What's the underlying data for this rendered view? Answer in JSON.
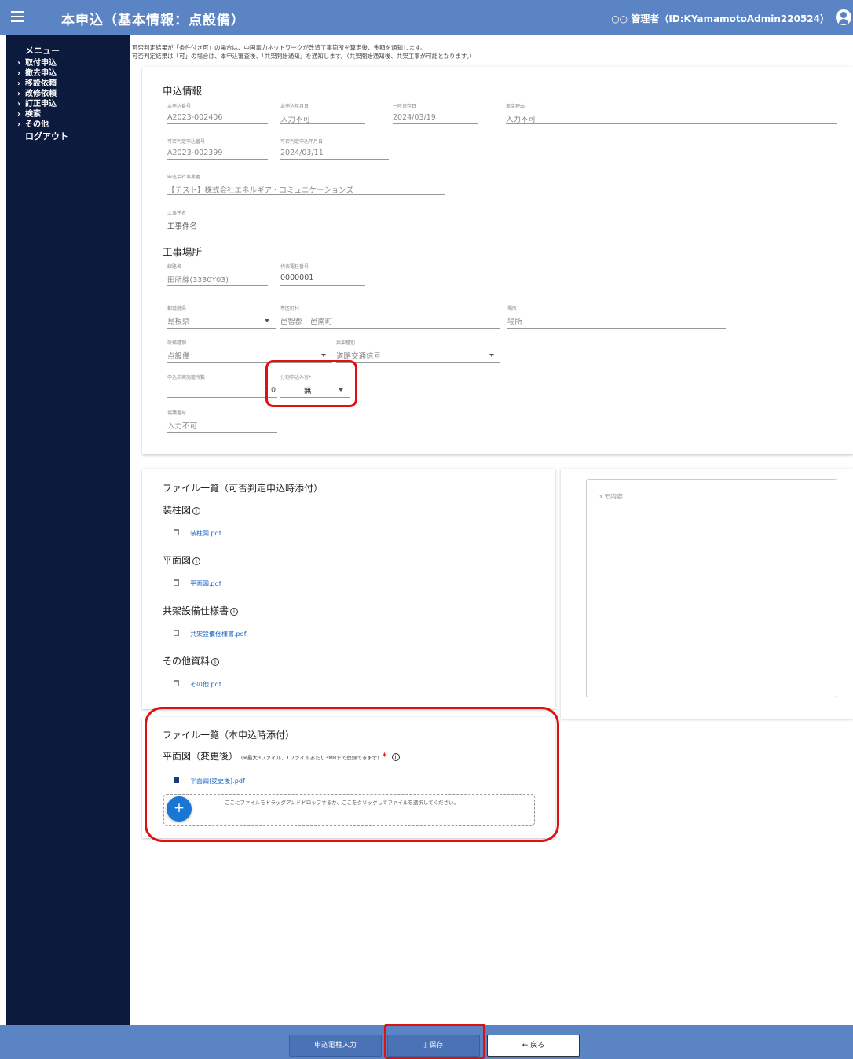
{
  "header": {
    "title": "本申込（基本情報：点設備）",
    "user": "○○ 管理者（ID:KYamamotoAdmin220524）"
  },
  "sidebar": {
    "title": "メニュー",
    "items": [
      {
        "label": "取付申込"
      },
      {
        "label": "撤去申込"
      },
      {
        "label": "移設依頼"
      },
      {
        "label": "改修依頼"
      },
      {
        "label": "訂正申込"
      },
      {
        "label": "検索"
      },
      {
        "label": "その他"
      }
    ],
    "logout": "ログアウト"
  },
  "notices": [
    "可否判定結果が「条件付き可」の場合は、中国電力ネットワークが改造工事箇所を算定後、金額を通知します。",
    "可否判定結果は「可」の場合は、本申込審査後、「共架開始通知」を通知します。（共架開始通知後、共架工事が可能となります。）"
  ],
  "application": {
    "section_title": "申込情報",
    "fields": {
      "app_number": {
        "label": "本申込番号",
        "value": "A2023-002406"
      },
      "app_date": {
        "label": "本申込年月日",
        "value": "入力不可"
      },
      "save_date": {
        "label": "一時保存日",
        "value": "2024/03/19"
      },
      "reject_reason": {
        "label": "差戻理由",
        "value": "入力不可"
      },
      "judge_number": {
        "label": "可否判定申込番号",
        "value": "A2023-002399"
      },
      "judge_date": {
        "label": "可否判定申込年月日",
        "value": "2024/03/11"
      },
      "applicant": {
        "label": "申込会社事業者",
        "value": "【テスト】株式会社エネルギア・コミュニケーションズ"
      },
      "construction_name": {
        "label": "工事件名",
        "value": "工事件名"
      }
    }
  },
  "location": {
    "section_title": "工事場所",
    "fields": {
      "line_name": {
        "label": "線路名",
        "value": "田所線(3330Y03)"
      },
      "pole_number": {
        "label": "代表電柱番号",
        "value": "0000001"
      },
      "prefecture": {
        "label": "都道府県",
        "value": "島根県"
      },
      "city": {
        "label": "市区町村",
        "value": "邑智郡　邑南町"
      },
      "place": {
        "label": "場所",
        "value": "場所"
      },
      "equipment_type": {
        "label": "設備種別",
        "value": "点設備"
      },
      "frame_type": {
        "label": "共架種別",
        "value": "道路交通信号"
      },
      "unconstructed_count": {
        "label": "申込未実施箇所数",
        "value": "0"
      },
      "split_apply": {
        "label": "分割申込み有",
        "value": "無"
      },
      "agreement_number": {
        "label": "協議番号",
        "value": "入力不可"
      }
    }
  },
  "files_judge": {
    "heading": "ファイル一覧（可否判定申込時添付）",
    "categories": [
      {
        "label": "装柱図",
        "file": "装柱図.pdf"
      },
      {
        "label": "平面図",
        "file": "平面図.pdf"
      },
      {
        "label": "共架設備仕様書",
        "file": "共架設備仕様書.pdf"
      },
      {
        "label": "その他資料",
        "file": "その他.pdf"
      }
    ]
  },
  "memo": {
    "placeholder": "メモ内容"
  },
  "files_main": {
    "heading": "ファイル一覧（本申込時添付）",
    "category": "平面図（変更後）",
    "note": "(※最大3ファイル、1ファイルあたり3MBまで登録できます)",
    "file": "平面図(変更後).pdf",
    "dropzone_text": "ここにファイルをドラッグアンドドロップするか、ここをクリックしてファイルを選択してください。"
  },
  "footer": {
    "pole_input": "申込電柱入力",
    "save": "保存",
    "back": "戻る"
  },
  "colors": {
    "header": "#5b84c4",
    "sidebar": "#0c1b3d",
    "highlight": "#e01010",
    "link": "#1565c0"
  }
}
